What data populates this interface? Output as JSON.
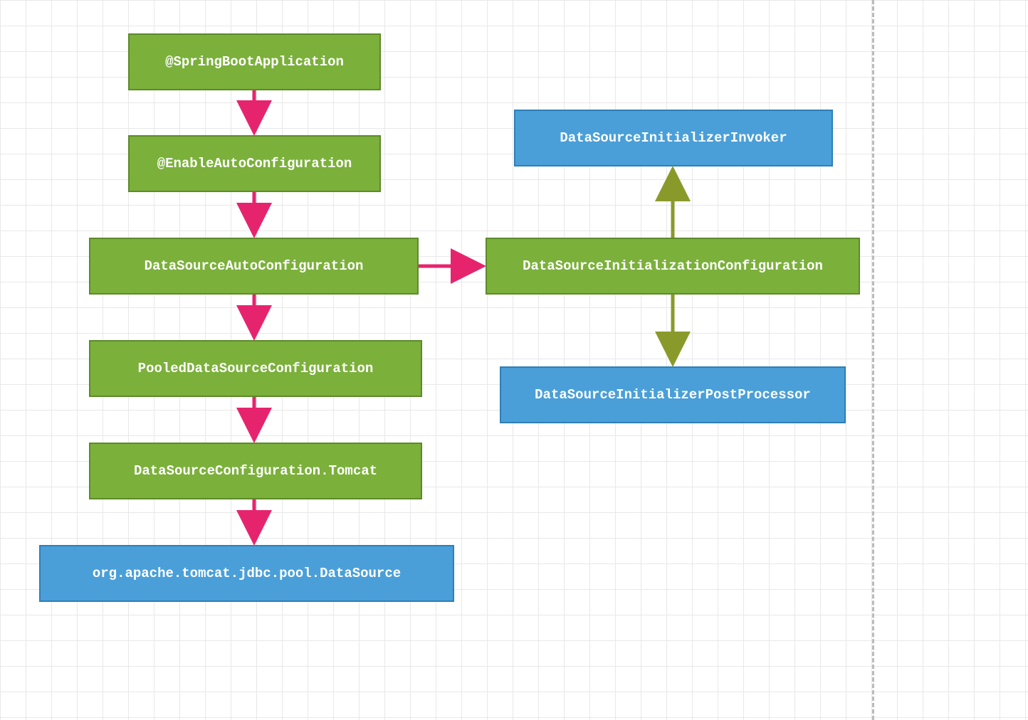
{
  "nodes": {
    "springBootApp": "@SpringBootApplication",
    "enableAutoConfig": "@EnableAutoConfiguration",
    "dataSourceAutoConfig": "DataSourceAutoConfiguration",
    "pooledDataSourceConfig": "PooledDataSourceConfiguration",
    "dataSourceConfigTomcat": "DataSourceConfiguration.Tomcat",
    "tomcatDataSource": "org.apache.tomcat.jdbc.pool.DataSource",
    "dataSourceInitConfig": "DataSourceInitializationConfiguration",
    "dataSourceInitInvoker": "DataSourceInitializerInvoker",
    "dataSourceInitPostProcessor": "DataSourceInitializerPostProcessor"
  },
  "colors": {
    "green": "#7bb03b",
    "greenBorder": "#5d8a2a",
    "blue": "#4a9fd8",
    "blueBorder": "#2e7fb8",
    "pinkArrow": "#e6246e",
    "oliveArrow": "#8a9a2a"
  },
  "edges": [
    {
      "from": "springBootApp",
      "to": "enableAutoConfig",
      "color": "pink"
    },
    {
      "from": "enableAutoConfig",
      "to": "dataSourceAutoConfig",
      "color": "pink"
    },
    {
      "from": "dataSourceAutoConfig",
      "to": "pooledDataSourceConfig",
      "color": "pink"
    },
    {
      "from": "pooledDataSourceConfig",
      "to": "dataSourceConfigTomcat",
      "color": "pink"
    },
    {
      "from": "dataSourceConfigTomcat",
      "to": "tomcatDataSource",
      "color": "pink"
    },
    {
      "from": "dataSourceAutoConfig",
      "to": "dataSourceInitConfig",
      "color": "pink"
    },
    {
      "from": "dataSourceInitConfig",
      "to": "dataSourceInitInvoker",
      "color": "olive"
    },
    {
      "from": "dataSourceInitConfig",
      "to": "dataSourceInitPostProcessor",
      "color": "olive"
    }
  ]
}
